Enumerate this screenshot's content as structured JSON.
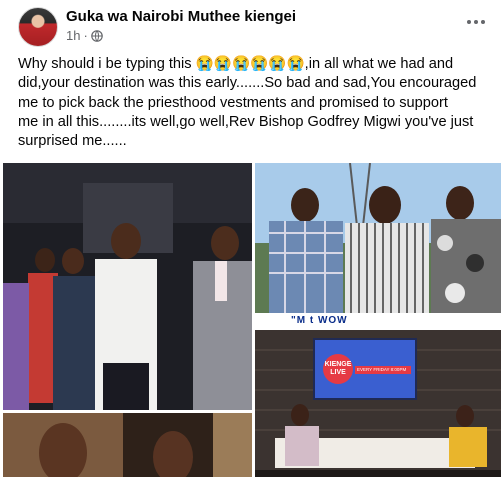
{
  "post": {
    "author": "Guka wa Nairobi Muthee kiengei",
    "time": "1h",
    "separator": "·",
    "privacy_icon": "globe-icon",
    "more_icon": "more-options-icon",
    "text_lines": [
      "Why should i be typing this 😭😭😭😭😭😭,in all what we had and",
      "did,your destination was this early.......So bad and sad,You encouraged",
      "me to pick back the priesthood vestments and promised to support",
      "me in all this........its well,go well,Rev Bishop Godfrey Migwi  you've just",
      "surprised me......"
    ]
  },
  "gallery": {
    "photos": [
      {
        "name": "photo-church-group",
        "desc_colors": [
          "#1b1c22",
          "#f2f2f2"
        ]
      },
      {
        "name": "photo-three-men-outdoors",
        "desc_colors": [
          "#9fc4e6"
        ]
      },
      {
        "name": "photo-tv-studio",
        "desc_colors": [
          "#2a2522"
        ]
      },
      {
        "name": "photo-close-up-faces",
        "desc_colors": [
          "#2d1f18"
        ]
      }
    ],
    "studio_logo": "KIENGE LIVE",
    "studio_strip": "EVERY FRIDAY 8:00PM",
    "banner_text": "\"M        t        WOW"
  },
  "colors": {
    "text": "#050505",
    "meta": "#65676b"
  }
}
